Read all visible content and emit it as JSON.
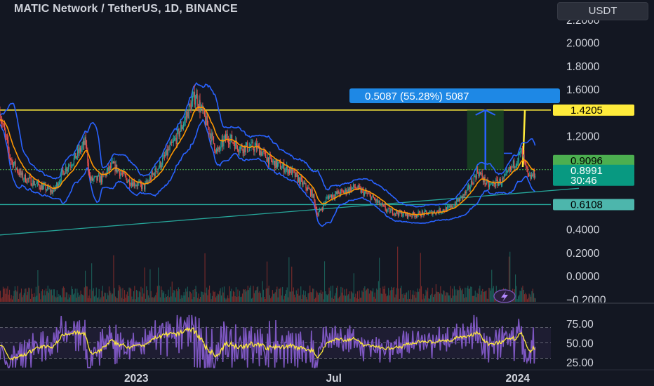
{
  "header": {
    "title": "MATIC Network / TetherUS, 1D, BINANCE",
    "currency_button": "USDT"
  },
  "colors": {
    "background": "#131722",
    "candle_up": "#26a69a",
    "candle_down": "#ef5350",
    "bollinger": "#2962ff",
    "ema": "#ff9800",
    "resistance": "#ffeb3b",
    "support": "#26a69a",
    "trendline": "#26a69a",
    "measure_box": "#1b5e20",
    "measure_label": "#1e88e5",
    "rsi_line": "#7e57c2",
    "rsi_signal": "#ffeb3b"
  },
  "chart_data": {
    "type": "candlestick",
    "symbol": "MATIC Network / TetherUS",
    "timeframe": "1D",
    "exchange": "BINANCE",
    "ylim": [
      -0.2,
      2.2
    ],
    "y_ticks": [
      "2.0000",
      "1.8000",
      "1.6000",
      "1.2000",
      "0.4000",
      "0.2000",
      "0.0000",
      "−0.2000"
    ],
    "x_ticks": [
      "2023",
      "Jul",
      "2024"
    ],
    "x_start": "2022-08-15",
    "x_end": "2024-02-20",
    "price_path": [
      [
        "2022-08-15",
        1.4
      ],
      [
        "2022-08-25",
        1.0
      ],
      [
        "2022-09-05",
        0.85
      ],
      [
        "2022-09-20",
        0.78
      ],
      [
        "2022-10-05",
        0.72
      ],
      [
        "2022-10-15",
        0.9
      ],
      [
        "2022-10-25",
        1.0
      ],
      [
        "2022-11-05",
        1.15
      ],
      [
        "2022-11-09",
        0.82
      ],
      [
        "2022-11-20",
        0.83
      ],
      [
        "2022-12-01",
        0.95
      ],
      [
        "2022-12-15",
        0.82
      ],
      [
        "2022-12-31",
        0.76
      ],
      [
        "2023-01-15",
        0.95
      ],
      [
        "2023-02-01",
        1.2
      ],
      [
        "2023-02-18",
        1.55
      ],
      [
        "2023-03-01",
        1.3
      ],
      [
        "2023-03-11",
        1.05
      ],
      [
        "2023-03-20",
        1.2
      ],
      [
        "2023-04-01",
        1.1
      ],
      [
        "2023-04-18",
        1.1
      ],
      [
        "2023-05-01",
        0.98
      ],
      [
        "2023-05-20",
        0.9
      ],
      [
        "2023-06-10",
        0.7
      ],
      [
        "2023-06-15",
        0.52
      ],
      [
        "2023-06-25",
        0.68
      ],
      [
        "2023-07-10",
        0.72
      ],
      [
        "2023-07-20",
        0.76
      ],
      [
        "2023-08-05",
        0.68
      ],
      [
        "2023-08-20",
        0.56
      ],
      [
        "2023-09-10",
        0.52
      ],
      [
        "2023-10-01",
        0.54
      ],
      [
        "2023-10-20",
        0.58
      ],
      [
        "2023-11-05",
        0.72
      ],
      [
        "2023-11-15",
        0.9
      ],
      [
        "2023-11-25",
        0.77
      ],
      [
        "2023-12-10",
        0.82
      ],
      [
        "2023-12-27",
        1.06
      ],
      [
        "2024-01-03",
        0.83
      ],
      [
        "2024-01-10",
        0.89
      ]
    ],
    "lines": [
      {
        "name": "resistance",
        "y": 1.4205
      },
      {
        "name": "pivot",
        "y": 0.9096
      },
      {
        "name": "support",
        "y": 0.6108
      },
      {
        "name": "trendline",
        "from": [
          "2022-08-15",
          0.35
        ],
        "to": [
          "2024-02-20",
          0.75
        ]
      }
    ],
    "price_tags": [
      {
        "label": "1.4205",
        "y": 1.4205
      },
      {
        "label": "0.9096",
        "y": 0.9096
      },
      {
        "label": "0.8991",
        "y": 0.8991
      },
      {
        "label": "30:46",
        "y": 0.8991
      },
      {
        "label": "0.6108",
        "y": 0.6108
      }
    ],
    "measure": {
      "label": "0.5087 (55.28%) 5087",
      "from": [
        "2023-11-05",
        0.9096
      ],
      "to": [
        "2023-12-10",
        1.4205
      ],
      "target_price": 1.4205
    },
    "rsi": {
      "ylim": [
        10,
        90
      ],
      "y_ticks": [
        "75.00",
        "50.00",
        "25.00"
      ],
      "band_upper": 70,
      "band_mid": 50,
      "band_lower": 30
    }
  }
}
